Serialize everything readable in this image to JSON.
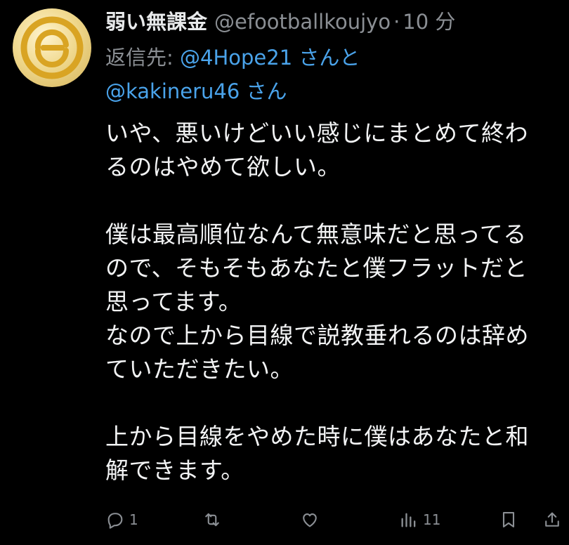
{
  "tweet": {
    "display_name": "弱い無課金",
    "handle": "@efootballkoujyo",
    "separator": "·",
    "time": "10 分",
    "reply_prefix": "返信先: ",
    "mention1": "@4Hope21",
    "mention1_suffix": " さんと",
    "mention2": "@kakineru46",
    "mention2_suffix": " さん",
    "body": {
      "line1": "いや、悪いけどいい感じにまとめて終わ",
      "line2": "るのはやめて欲しい。",
      "line3": "僕は最高順位なんて無意味だと思ってる",
      "line4": "ので、そもそもあなたと僕フラットだと",
      "line5": "思ってます。",
      "line6": "なので上から目線で説教垂れるのは辞め",
      "line7": "ていただきたい。",
      "line8": "上から目線をやめた時に僕はあなたと和",
      "line9": "解できます。"
    }
  },
  "actions": {
    "reply_count": "1",
    "retweet_count": "",
    "like_count": "",
    "views_count": "11"
  },
  "colors": {
    "background": "#000000",
    "text": "#e7e9ea",
    "secondary": "#8b8f94",
    "mention": "#4aa3ea",
    "avatar_gold": "#d9a423"
  },
  "icons": [
    "reply-icon",
    "retweet-icon",
    "like-icon",
    "views-icon",
    "bookmark-icon",
    "share-icon"
  ]
}
